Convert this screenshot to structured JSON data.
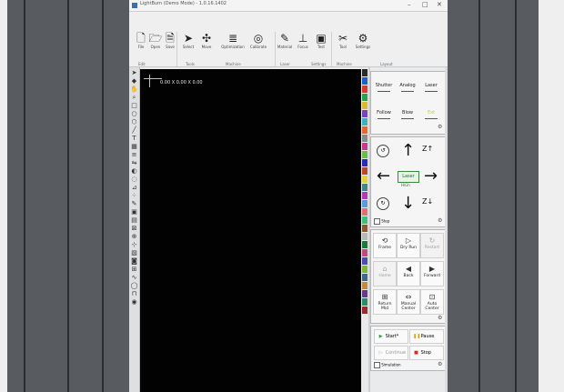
{
  "window": {
    "title": "LightBurn (Demo Mode) - 1.0.16.1402",
    "controls": [
      "–",
      "□",
      "✕"
    ]
  },
  "ribbon": {
    "buttons": [
      {
        "icon": "file-icon",
        "glyph": "🗋",
        "label": "File"
      },
      {
        "icon": "open-icon",
        "glyph": "🗁",
        "label": "Open"
      },
      {
        "icon": "save-icon",
        "glyph": "🗎",
        "label": "Save"
      },
      {
        "icon": "select-icon",
        "glyph": "➤",
        "label": "Select"
      },
      {
        "icon": "move-icon",
        "glyph": "✣",
        "label": "Move"
      },
      {
        "icon": "opt-icon",
        "glyph": "≣",
        "label": "Optimization"
      },
      {
        "icon": "calib-icon",
        "glyph": "◎",
        "label": "Calibrate"
      },
      {
        "icon": "material-icon",
        "glyph": "✎",
        "label": "Material"
      },
      {
        "icon": "focus-icon",
        "glyph": "⊥",
        "label": "Focus"
      },
      {
        "icon": "test-icon",
        "glyph": "▣",
        "label": "Test"
      },
      {
        "icon": "tool-icon",
        "glyph": "✂",
        "label": "Tool"
      },
      {
        "icon": "settings-icon",
        "glyph": "⚙",
        "label": "Settings"
      }
    ],
    "groups": [
      "Edit",
      "Tools",
      "Machine",
      "Laser",
      "Settings",
      "Machine",
      "Layout"
    ]
  },
  "canvas": {
    "coord_readout": "0.00 X 0.00 X 0.00"
  },
  "palette": {
    "colors": [
      "#2a2a2a",
      "#1e5fbf",
      "#d93a2b",
      "#2aa24a",
      "#e2b534",
      "#7a44b4",
      "#3ab0c8",
      "#e06a2a",
      "#8a8a8a",
      "#c83a8e",
      "#6bbf3a",
      "#2a2ab8",
      "#b84a2a",
      "#e4d23a",
      "#3a8a8a",
      "#b43ab4",
      "#5a9ae0",
      "#e07070",
      "#3ac07a",
      "#8a5a2a",
      "#b8b8b8",
      "#1a7a3a",
      "#c04a7a",
      "#4a4ab8",
      "#7ab83a",
      "#3a6a8a",
      "#c8883a",
      "#6a3a8a",
      "#2a8a6a",
      "#9a2a2a"
    ]
  },
  "laser_panel": {
    "items": [
      "Shutter",
      "Analog",
      "Laser",
      "Follow",
      "Blow",
      "Ext"
    ]
  },
  "jog_panel": {
    "center_label": "Laser",
    "center_sub": "HiGh",
    "step_label": "Step",
    "rot_ccw": "↺",
    "rot_cw": "↻",
    "z_up": "Z↑",
    "z_down": "Z↓"
  },
  "frame_panel": {
    "cells": [
      {
        "icon": "frame-icon",
        "glyph": "⟲",
        "label": "Frame",
        "dim": false
      },
      {
        "icon": "dryrun-icon",
        "glyph": "▷",
        "label": "Dry Run",
        "dim": false
      },
      {
        "icon": "restart-icon",
        "glyph": "↻",
        "label": "Restart",
        "dim": true
      },
      {
        "icon": "home-icon",
        "glyph": "⌂",
        "label": "Home",
        "dim": true
      },
      {
        "icon": "back-icon",
        "glyph": "◀",
        "label": "Back",
        "dim": false
      },
      {
        "icon": "forward-icon",
        "glyph": "▶",
        "label": "Forward",
        "dim": false
      },
      {
        "icon": "return-icon",
        "glyph": "⊞",
        "label": "Return Mid",
        "dim": false
      },
      {
        "icon": "manual-icon",
        "glyph": "⇔",
        "label": "Manual Center",
        "dim": false
      },
      {
        "icon": "auto-icon",
        "glyph": "⊡",
        "label": "Auto Center",
        "dim": false
      }
    ]
  },
  "action_panel": {
    "start": "Start*",
    "pause": "Pause",
    "continue": "Continue",
    "stop": "Stop",
    "simulation": "Simulation"
  }
}
